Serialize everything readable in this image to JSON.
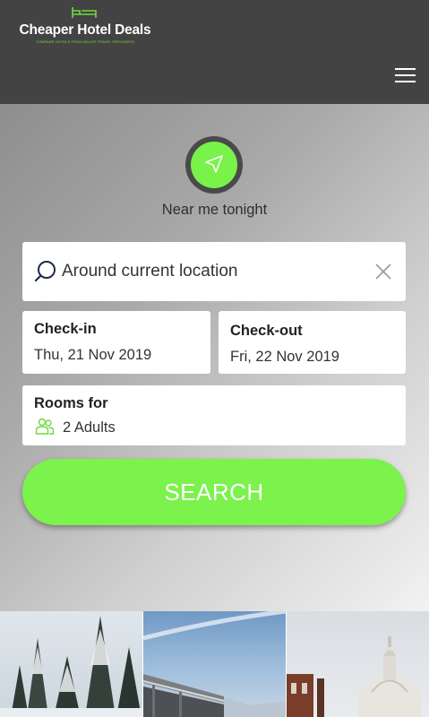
{
  "header": {
    "brand_title": "Cheaper Hotel Deals",
    "brand_tagline": "COMPARE HOTELS FROM MAJOR TRAVEL PROVIDERS",
    "logo_icon": "bed-icon",
    "menu_icon": "hamburger-menu-icon"
  },
  "near_me": {
    "label": "Near me tonight",
    "icon": "navigation-arrow-icon"
  },
  "search": {
    "value": "Around current location",
    "icon": "search-icon",
    "clear_icon": "close-icon"
  },
  "check_in": {
    "label": "Check-in",
    "value": "Thu, 21 Nov 2019"
  },
  "check_out": {
    "label": "Check-out",
    "value": "Fri, 22 Nov 2019"
  },
  "rooms": {
    "label": "Rooms for",
    "value": "2 Adults",
    "icon": "people-icon"
  },
  "search_button": {
    "label": "SEARCH"
  },
  "gallery": {
    "photos": [
      "snowy-forest-photo",
      "bridge-photo",
      "cathedral-dome-photo"
    ]
  },
  "colors": {
    "accent": "#7cf24c",
    "header_bg": "#434343",
    "tagline": "#6fd93f"
  }
}
